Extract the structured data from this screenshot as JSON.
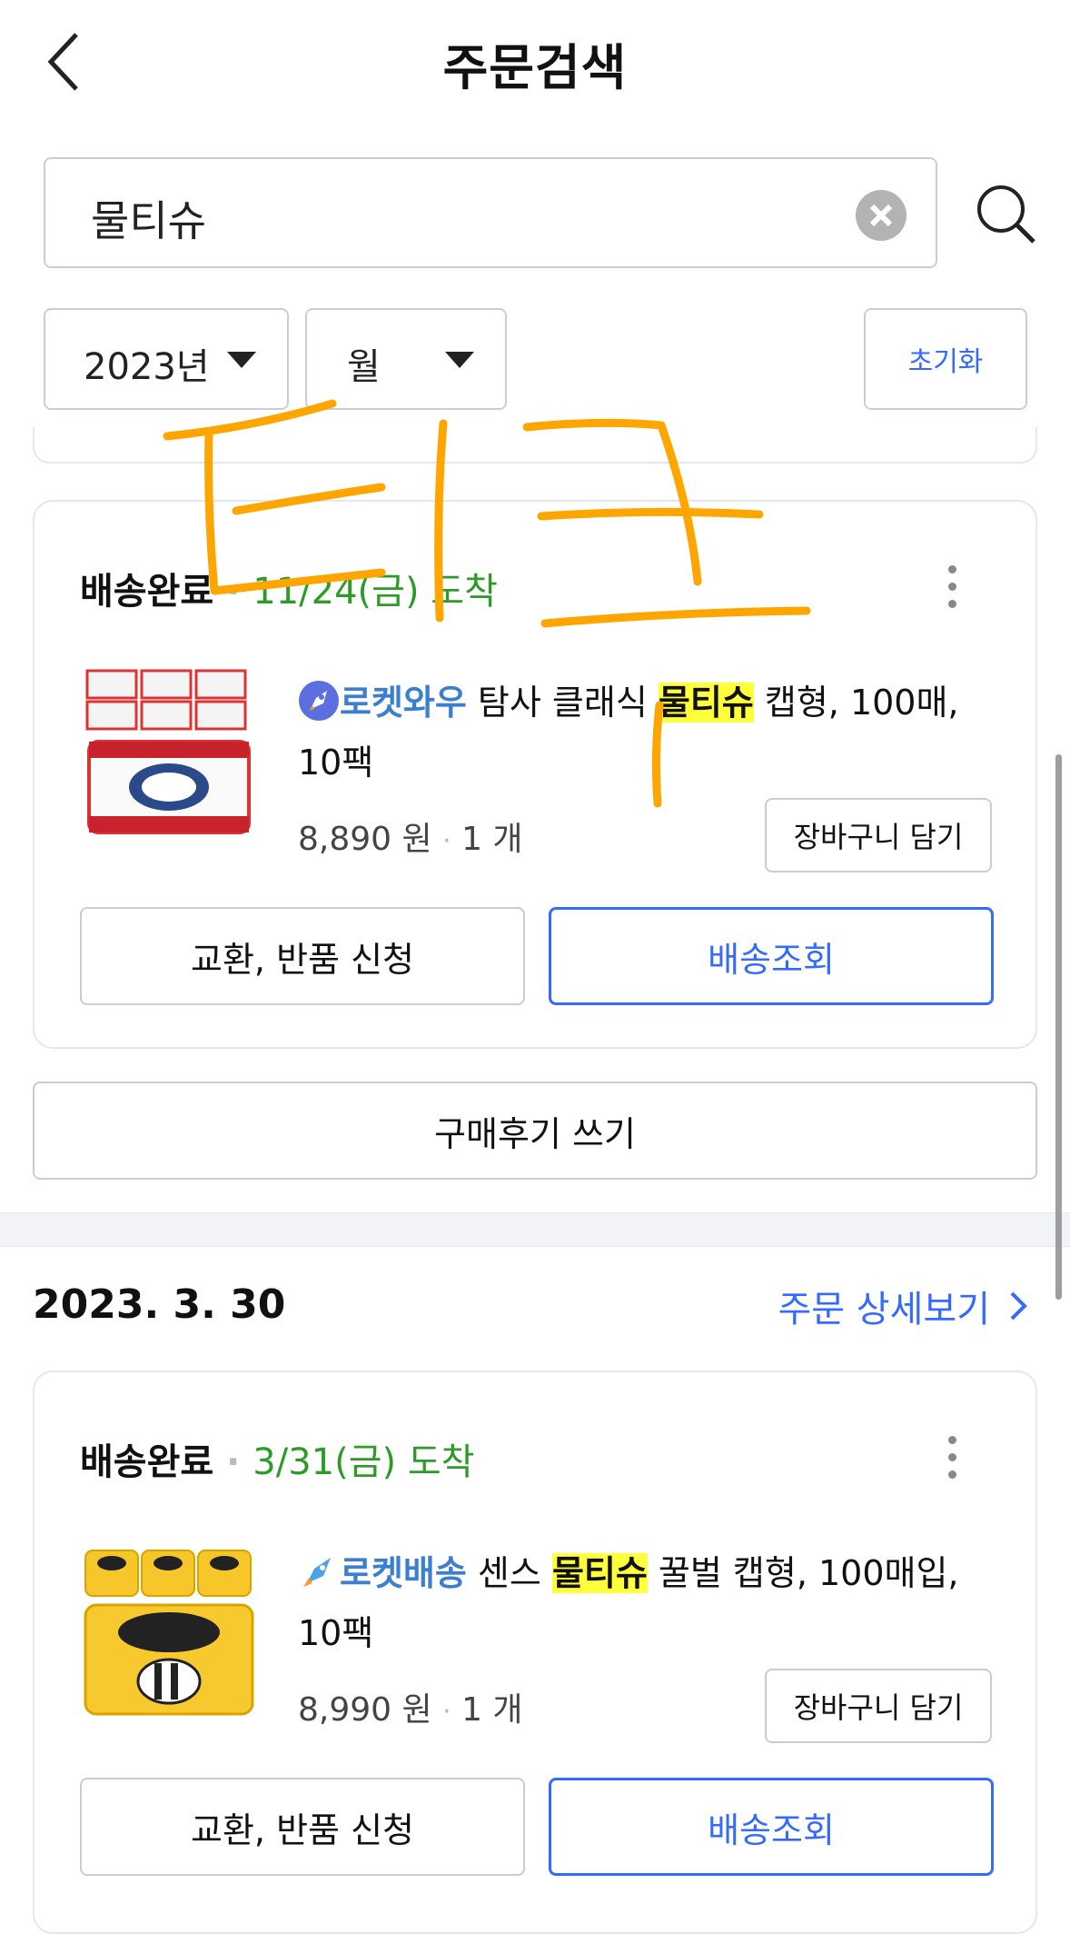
{
  "header": {
    "title": "주문검색"
  },
  "search": {
    "value": "물티슈"
  },
  "filters": {
    "year": "2023년",
    "month": "월",
    "reset_label": "초기화"
  },
  "orders": [
    {
      "status": "배송완료",
      "arrival": "11/24(금) 도착",
      "badge": "로켓와우",
      "title_before": " 탐사 클래식 ",
      "highlight": "물티슈",
      "title_after": " 캡형, 100매, 10팩",
      "price": "8,890 원",
      "quantity": "1 개",
      "cart_label": "장바구니 담기",
      "exchange_label": "교환, 반품 신청",
      "tracking_label": "배송조회",
      "review_label": "구매후기 쓰기"
    },
    {
      "date": "2023. 3. 30",
      "detail_label": "주문 상세보기",
      "status": "배송완료",
      "arrival": "3/31(금) 도착",
      "badge": "로켓배송",
      "title_before": " 센스 ",
      "highlight": "물티슈",
      "title_after": " 꿀벌 캡형, 100매입, 10팩",
      "price": "8,990 원",
      "quantity": "1 개",
      "cart_label": "장바구니 담기",
      "exchange_label": "교환, 반품 신청",
      "tracking_label": "배송조회"
    }
  ],
  "colors": {
    "accent": "#346aff",
    "arrival_green": "#2e9b29",
    "highlight": "#ffff3a",
    "badge_blue": "#3c7fd0",
    "scribble": "#ffa500"
  },
  "icons": [
    "back-arrow-icon",
    "clear-icon",
    "search-icon",
    "caret-down-icon",
    "kebab-icon",
    "rocket-icon",
    "chevron-right-icon"
  ]
}
